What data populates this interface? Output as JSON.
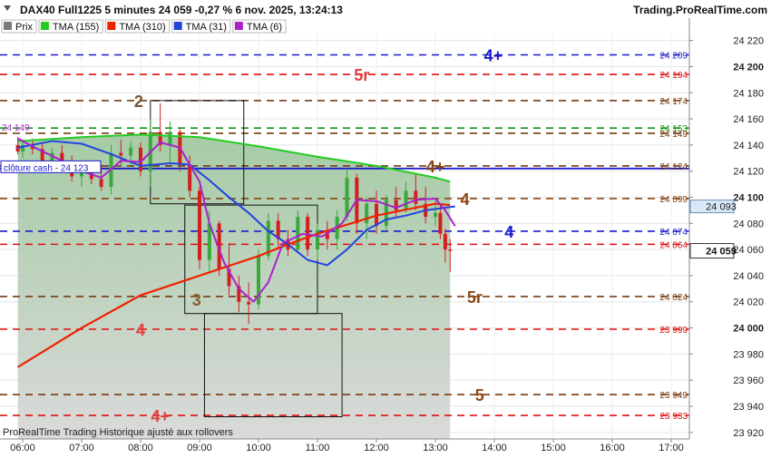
{
  "header": {
    "instrument": "DAX40 Full1225 5 minutes 24 059 -0,27 % 6 nov. 2025, 13:24:13",
    "brand": "Trading.ProRealTime.com"
  },
  "legend": [
    {
      "label": "Prix",
      "color": "#7a7a7a"
    },
    {
      "label": "TMA (155)",
      "color": "#22cc22"
    },
    {
      "label": "TMA (310)",
      "color": "#ee2200"
    },
    {
      "label": "TMA (31)",
      "color": "#2244dd"
    },
    {
      "label": "TMA (6)",
      "color": "#aa22cc"
    }
  ],
  "footer": "ProRealTime Trading  Historique ajusté aux rollovers",
  "chart_data": {
    "type": "candlestick",
    "ylim": [
      23915,
      24226
    ],
    "yticks": [
      24220,
      24200,
      24180,
      24160,
      24140,
      24120,
      24100,
      24080,
      24060,
      24040,
      24020,
      24000,
      23980,
      23960,
      23940,
      23920
    ],
    "ytick_labels": [
      "24 220",
      "24 200",
      "24 180",
      "24 160",
      "24 140",
      "24 120",
      "24 100",
      "24 080",
      "24 060",
      "24 040",
      "24 020",
      "24 000",
      "23 980",
      "23 960",
      "23 940",
      "23 920"
    ],
    "bold_ticks": [
      "24 200",
      "24 100",
      "24 000"
    ],
    "xlim": [
      "06:00",
      "17:30"
    ],
    "xticks": [
      "06:00",
      "07:00",
      "08:00",
      "09:00",
      "10:00",
      "11:00",
      "12:00",
      "13:00",
      "14:00",
      "15:00",
      "16:00",
      "17:00"
    ],
    "last_price": {
      "value": 24059,
      "label": "24 059"
    },
    "tma6_label": {
      "value": 24093,
      "label": "24 093"
    },
    "cloture_cash": {
      "value": 24123,
      "label": "clôture cash -  24 123"
    },
    "levels": [
      {
        "value": 24209,
        "label": "24 209",
        "color": "#1a1acc",
        "dash": "8,6",
        "text": "4+",
        "text_time": "13:59",
        "text_color": "#1a1acc"
      },
      {
        "value": 24194,
        "label": "24 194",
        "color": "#dd1111",
        "dash": "8,6",
        "text": "5r",
        "text_time": "11:45",
        "text_color": "#e04040"
      },
      {
        "value": 24174,
        "label": "24 174",
        "color": "#7a3a10",
        "dash": "8,6",
        "text": "2",
        "text_time": "07:58",
        "text_color": "#7a5530"
      },
      {
        "value": 24153,
        "label": "24 153",
        "color": "#159915",
        "dash": "8,6",
        "text": "",
        "text_time": ""
      },
      {
        "value": 24149,
        "label": "24 149",
        "color": "#7a3a10",
        "dash": "8,6",
        "text": "",
        "text_time": ""
      },
      {
        "value": 24124,
        "label": "24 124",
        "color": "#7a3a10",
        "dash": "8,6",
        "text": "4+",
        "text_time": "13:00",
        "text_color": "#8b4513"
      },
      {
        "value": 24122,
        "label": "",
        "color": "#1a1acc",
        "dash": "",
        "text": "",
        "text_time": ""
      },
      {
        "value": 24099,
        "label": "24 099",
        "color": "#8b4513",
        "dash": "8,6",
        "text": "4",
        "text_time": "13:30",
        "text_color": "#8b4513"
      },
      {
        "value": 24074,
        "label": "24 074",
        "color": "#1a1acc",
        "dash": "8,6",
        "text": "4",
        "text_time": "14:15",
        "text_color": "#1a1acc"
      },
      {
        "value": 24064,
        "label": "24 064",
        "color": "#dd1111",
        "dash": "8,6",
        "text": "",
        "text_time": ""
      },
      {
        "value": 24024,
        "label": "24 024",
        "color": "#7a3a10",
        "dash": "8,6",
        "text": "5r",
        "text_time": "13:40",
        "text_color": "#8b4513"
      },
      {
        "value": 23999,
        "label": "23 999",
        "color": "#dd1111",
        "dash": "8,6",
        "text": "4",
        "text_time": "08:00",
        "text_color": "#e04040"
      },
      {
        "value": 23949,
        "label": "23 949",
        "color": "#7a3a10",
        "dash": "8,6",
        "text": "5",
        "text_time": "13:45",
        "text_color": "#8b4513"
      },
      {
        "value": 23933,
        "label": "23 933",
        "color": "#dd1111",
        "dash": "8,6",
        "text": "4+",
        "text_time": "08:20",
        "text_color": "#e04040"
      }
    ],
    "wave_labels": [
      {
        "text": "3",
        "time": "08:57",
        "value": 24022,
        "color": "#8b5e34"
      }
    ],
    "boxes": [
      {
        "t1": "08:10",
        "t2": "09:45",
        "y1": 24174,
        "y2": 24095
      },
      {
        "t1": "08:45",
        "t2": "11:00",
        "y1": 24094,
        "y2": 24011
      },
      {
        "t1": "09:05",
        "t2": "11:25",
        "y1": 24011,
        "y2": 23932
      }
    ],
    "candles": [
      {
        "t": "05:55",
        "o": 24140,
        "h": 24146,
        "l": 24133,
        "c": 24135
      },
      {
        "t": "06:00",
        "o": 24135,
        "h": 24143,
        "l": 24130,
        "c": 24140
      },
      {
        "t": "06:10",
        "o": 24140,
        "h": 24145,
        "l": 24133,
        "c": 24137
      },
      {
        "t": "06:20",
        "o": 24137,
        "h": 24141,
        "l": 24124,
        "c": 24127
      },
      {
        "t": "06:30",
        "o": 24127,
        "h": 24138,
        "l": 24125,
        "c": 24134
      },
      {
        "t": "06:40",
        "o": 24134,
        "h": 24140,
        "l": 24124,
        "c": 24128
      },
      {
        "t": "06:50",
        "o": 24128,
        "h": 24132,
        "l": 24112,
        "c": 24116
      },
      {
        "t": "07:00",
        "o": 24116,
        "h": 24126,
        "l": 24108,
        "c": 24120
      },
      {
        "t": "07:10",
        "o": 24120,
        "h": 24124,
        "l": 24110,
        "c": 24114
      },
      {
        "t": "07:20",
        "o": 24114,
        "h": 24125,
        "l": 24105,
        "c": 24108
      },
      {
        "t": "07:30",
        "o": 24108,
        "h": 24140,
        "l": 24102,
        "c": 24134
      },
      {
        "t": "07:40",
        "o": 24134,
        "h": 24144,
        "l": 24125,
        "c": 24132
      },
      {
        "t": "07:50",
        "o": 24132,
        "h": 24143,
        "l": 24125,
        "c": 24138
      },
      {
        "t": "08:00",
        "o": 24138,
        "h": 24142,
        "l": 24116,
        "c": 24120
      },
      {
        "t": "08:10",
        "o": 24120,
        "h": 24160,
        "l": 24108,
        "c": 24150
      },
      {
        "t": "08:20",
        "o": 24150,
        "h": 24172,
        "l": 24135,
        "c": 24140
      },
      {
        "t": "08:30",
        "o": 24140,
        "h": 24158,
        "l": 24125,
        "c": 24150
      },
      {
        "t": "08:40",
        "o": 24150,
        "h": 24152,
        "l": 24120,
        "c": 24125
      },
      {
        "t": "08:50",
        "o": 24125,
        "h": 24132,
        "l": 24100,
        "c": 24105
      },
      {
        "t": "09:00",
        "o": 24105,
        "h": 24108,
        "l": 24045,
        "c": 24052
      },
      {
        "t": "09:10",
        "o": 24052,
        "h": 24090,
        "l": 24042,
        "c": 24080
      },
      {
        "t": "09:20",
        "o": 24080,
        "h": 24082,
        "l": 24040,
        "c": 24045
      },
      {
        "t": "09:30",
        "o": 24045,
        "h": 24065,
        "l": 24025,
        "c": 24032
      },
      {
        "t": "09:40",
        "o": 24032,
        "h": 24040,
        "l": 24012,
        "c": 24020
      },
      {
        "t": "09:50",
        "o": 24020,
        "h": 24035,
        "l": 24003,
        "c": 24018
      },
      {
        "t": "10:00",
        "o": 24018,
        "h": 24060,
        "l": 24014,
        "c": 24055
      },
      {
        "t": "10:10",
        "o": 24055,
        "h": 24088,
        "l": 24052,
        "c": 24082
      },
      {
        "t": "10:20",
        "o": 24082,
        "h": 24088,
        "l": 24060,
        "c": 24068
      },
      {
        "t": "10:30",
        "o": 24068,
        "h": 24075,
        "l": 24055,
        "c": 24060
      },
      {
        "t": "10:40",
        "o": 24060,
        "h": 24090,
        "l": 24058,
        "c": 24085
      },
      {
        "t": "10:50",
        "o": 24085,
        "h": 24088,
        "l": 24055,
        "c": 24060
      },
      {
        "t": "11:00",
        "o": 24060,
        "h": 24080,
        "l": 24052,
        "c": 24075
      },
      {
        "t": "11:10",
        "o": 24075,
        "h": 24082,
        "l": 24060,
        "c": 24068
      },
      {
        "t": "11:20",
        "o": 24068,
        "h": 24090,
        "l": 24060,
        "c": 24085
      },
      {
        "t": "11:30",
        "o": 24085,
        "h": 24122,
        "l": 24082,
        "c": 24115
      },
      {
        "t": "11:40",
        "o": 24115,
        "h": 24118,
        "l": 24072,
        "c": 24080
      },
      {
        "t": "11:50",
        "o": 24080,
        "h": 24100,
        "l": 24068,
        "c": 24095
      },
      {
        "t": "12:00",
        "o": 24095,
        "h": 24105,
        "l": 24072,
        "c": 24078
      },
      {
        "t": "12:10",
        "o": 24078,
        "h": 24102,
        "l": 24075,
        "c": 24098
      },
      {
        "t": "12:20",
        "o": 24098,
        "h": 24108,
        "l": 24085,
        "c": 24090
      },
      {
        "t": "12:30",
        "o": 24090,
        "h": 24112,
        "l": 24088,
        "c": 24105
      },
      {
        "t": "12:40",
        "o": 24105,
        "h": 24118,
        "l": 24090,
        "c": 24095
      },
      {
        "t": "12:50",
        "o": 24095,
        "h": 24108,
        "l": 24080,
        "c": 24085
      },
      {
        "t": "13:00",
        "o": 24085,
        "h": 24098,
        "l": 24078,
        "c": 24088
      },
      {
        "t": "13:05",
        "o": 24088,
        "h": 24094,
        "l": 24068,
        "c": 24072
      },
      {
        "t": "13:10",
        "o": 24072,
        "h": 24076,
        "l": 24050,
        "c": 24060
      },
      {
        "t": "13:15",
        "o": 24060,
        "h": 24068,
        "l": 24043,
        "c": 24059
      }
    ],
    "series": [
      {
        "name": "TMA (155)",
        "color": "#22cc22",
        "width": 2,
        "fill": "#8fbf8f",
        "points": [
          [
            "05:55",
            24143
          ],
          [
            "07:00",
            24146
          ],
          [
            "08:00",
            24148
          ],
          [
            "09:00",
            24146
          ],
          [
            "10:00",
            24139
          ],
          [
            "11:00",
            24131
          ],
          [
            "12:00",
            24124
          ],
          [
            "13:00",
            24115
          ],
          [
            "13:15",
            24112
          ]
        ]
      },
      {
        "name": "TMA (310)",
        "color": "#ee2200",
        "width": 2.2,
        "points": [
          [
            "05:55",
            23970
          ],
          [
            "07:00",
            24000
          ],
          [
            "08:00",
            24025
          ],
          [
            "09:00",
            24040
          ],
          [
            "10:00",
            24055
          ],
          [
            "10:30",
            24064
          ],
          [
            "11:00",
            24072
          ],
          [
            "12:00",
            24086
          ],
          [
            "13:00",
            24095
          ],
          [
            "13:15",
            24094
          ]
        ]
      },
      {
        "name": "TMA (31)",
        "color": "#2244dd",
        "width": 2,
        "points": [
          [
            "05:55",
            24138
          ],
          [
            "06:30",
            24143
          ],
          [
            "07:00",
            24141
          ],
          [
            "07:30",
            24133
          ],
          [
            "08:00",
            24124
          ],
          [
            "08:30",
            24126
          ],
          [
            "08:50",
            24125
          ],
          [
            "09:10",
            24113
          ],
          [
            "09:30",
            24100
          ],
          [
            "09:50",
            24088
          ],
          [
            "10:10",
            24074
          ],
          [
            "10:30",
            24064
          ],
          [
            "10:50",
            24052
          ],
          [
            "11:10",
            24048
          ],
          [
            "11:30",
            24060
          ],
          [
            "11:50",
            24075
          ],
          [
            "12:10",
            24083
          ],
          [
            "12:30",
            24086
          ],
          [
            "12:50",
            24090
          ],
          [
            "13:10",
            24092
          ],
          [
            "13:20",
            24093
          ]
        ]
      },
      {
        "name": "TMA (6)",
        "color": "#aa22cc",
        "width": 2,
        "points": [
          [
            "05:55",
            24145
          ],
          [
            "06:15",
            24137
          ],
          [
            "06:40",
            24128
          ],
          [
            "07:00",
            24120
          ],
          [
            "07:20",
            24115
          ],
          [
            "07:40",
            24128
          ],
          [
            "08:00",
            24127
          ],
          [
            "08:20",
            24142
          ],
          [
            "08:40",
            24138
          ],
          [
            "09:00",
            24112
          ],
          [
            "09:10",
            24080
          ],
          [
            "09:25",
            24050
          ],
          [
            "09:40",
            24030
          ],
          [
            "09:55",
            24020
          ],
          [
            "10:10",
            24035
          ],
          [
            "10:25",
            24065
          ],
          [
            "10:45",
            24072
          ],
          [
            "11:05",
            24070
          ],
          [
            "11:25",
            24080
          ],
          [
            "11:40",
            24098
          ],
          [
            "12:00",
            24097
          ],
          [
            "12:20",
            24092
          ],
          [
            "12:40",
            24098
          ],
          [
            "13:00",
            24099
          ],
          [
            "13:10",
            24090
          ],
          [
            "13:20",
            24078
          ]
        ]
      }
    ]
  }
}
